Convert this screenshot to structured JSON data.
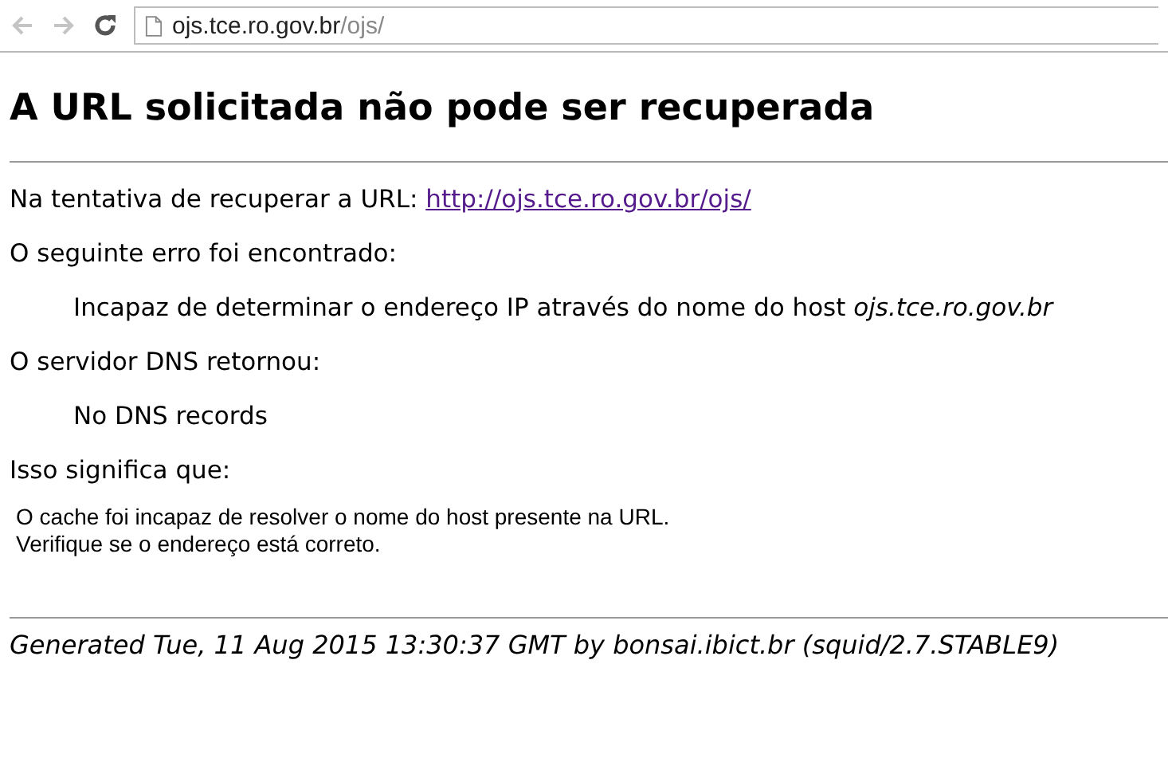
{
  "toolbar": {
    "back": {
      "disabled": true
    },
    "forward": {
      "disabled": true
    },
    "address": {
      "host": "ojs.tce.ro.gov.br",
      "path": "/ojs/"
    }
  },
  "heading": "A URL solicitada não pode ser recuperada",
  "intro": {
    "label": "Na tentativa de recuperar a URL:",
    "link": "http://ojs.tce.ro.gov.br/ojs/"
  },
  "error_label": "O seguinte erro foi encontrado:",
  "error_text": "Incapaz de determinar o endereço IP através do nome do host *ojs.tce.ro.gov.br*",
  "dns_label": "O servidor DNS retornou:",
  "dns_text": "No DNS records",
  "meaning_label": "Isso significa que:",
  "meaning_lines": [
    "O cache foi incapaz de resolver o nome do host presente na URL.",
    "Verifique se o endereço está correto."
  ],
  "footer": "Generated Tue, 11 Aug 2015 13:30:37 GMT by bonsai.ibict.br (squid/2.7.STABLE9)"
}
